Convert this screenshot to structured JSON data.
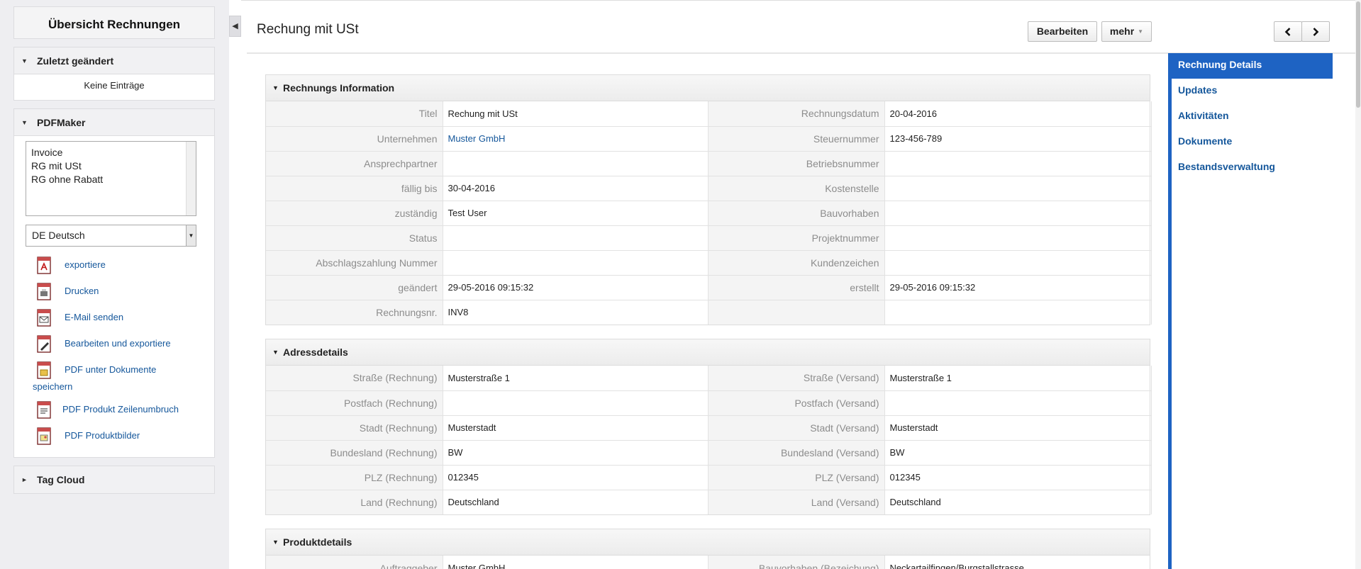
{
  "sidebar": {
    "title": "Übersicht Rechnungen",
    "recent": {
      "title": "Zuletzt geändert",
      "empty": "Keine Einträge"
    },
    "pdfmaker": {
      "title": "PDFMaker",
      "templates": [
        "Invoice",
        "RG mit USt",
        "RG ohne Rabatt"
      ],
      "language": "DE Deutsch",
      "actions": [
        "exportiere",
        "Drucken",
        "E-Mail senden",
        "Bearbeiten und exportiere",
        "PDF unter Dokumente",
        "speichern",
        "PDF Produkt Zeilenumbruch",
        "PDF Produktbilder"
      ]
    },
    "tagcloud": {
      "title": "Tag Cloud"
    }
  },
  "header": {
    "title": "Rechung mit USt",
    "edit_label": "Bearbeiten",
    "more_label": "mehr"
  },
  "nav": {
    "items": [
      "Rechnung Details",
      "Updates",
      "Aktivitäten",
      "Dokumente",
      "Bestandsverwaltung"
    ]
  },
  "colors": {
    "accent": "#1e63c3",
    "link": "#15579b"
  },
  "sections": [
    {
      "title": "Rechnungs Information",
      "rows": [
        {
          "l1": "Titel",
          "v1": "Rechung mit USt",
          "l2": "Rechnungsdatum",
          "v2": "20-04-2016"
        },
        {
          "l1": "Unternehmen",
          "v1": "Muster GmbH",
          "l2": "Steuernummer",
          "v2": "123-456-789"
        },
        {
          "l1": "Ansprechpartner",
          "v1": "",
          "l2": "Betriebsnummer",
          "v2": ""
        },
        {
          "l1": "fällig bis",
          "v1": "30-04-2016",
          "l2": "Kostenstelle",
          "v2": ""
        },
        {
          "l1": "zuständig",
          "v1": "Test User",
          "l2": "Bauvorhaben",
          "v2": ""
        },
        {
          "l1": "Status",
          "v1": "",
          "l2": "Projektnummer",
          "v2": ""
        },
        {
          "l1": "Abschlagszahlung Nummer",
          "v1": "",
          "l2": "Kundenzeichen",
          "v2": ""
        },
        {
          "l1": "geändert",
          "v1": "29-05-2016 09:15:32",
          "l2": "erstellt",
          "v2": "29-05-2016 09:15:32"
        },
        {
          "l1": "Rechnungsnr.",
          "v1": "INV8",
          "l2": "",
          "v2": ""
        }
      ]
    },
    {
      "title": "Adressdetails",
      "rows": [
        {
          "l1": "Straße (Rechnung)",
          "v1": "Musterstraße 1",
          "l2": "Straße (Versand)",
          "v2": "Musterstraße 1"
        },
        {
          "l1": "Postfach (Rechnung)",
          "v1": "",
          "l2": "Postfach (Versand)",
          "v2": ""
        },
        {
          "l1": "Stadt (Rechnung)",
          "v1": "Musterstadt",
          "l2": "Stadt (Versand)",
          "v2": "Musterstadt"
        },
        {
          "l1": "Bundesland (Rechnung)",
          "v1": "BW",
          "l2": "Bundesland (Versand)",
          "v2": "BW"
        },
        {
          "l1": "PLZ (Rechnung)",
          "v1": "012345",
          "l2": "PLZ (Versand)",
          "v2": "012345"
        },
        {
          "l1": "Land (Rechnung)",
          "v1": "Deutschland",
          "l2": "Land (Versand)",
          "v2": "Deutschland"
        }
      ]
    },
    {
      "title": "Produktdetails",
      "rows": [
        {
          "l1": "Auftraggeber",
          "v1": "Muster GmbH",
          "l2": "Bauvorhaben (Bezeichung)",
          "v2": "Neckartailfingen/Burgstallstrasse"
        }
      ]
    }
  ]
}
